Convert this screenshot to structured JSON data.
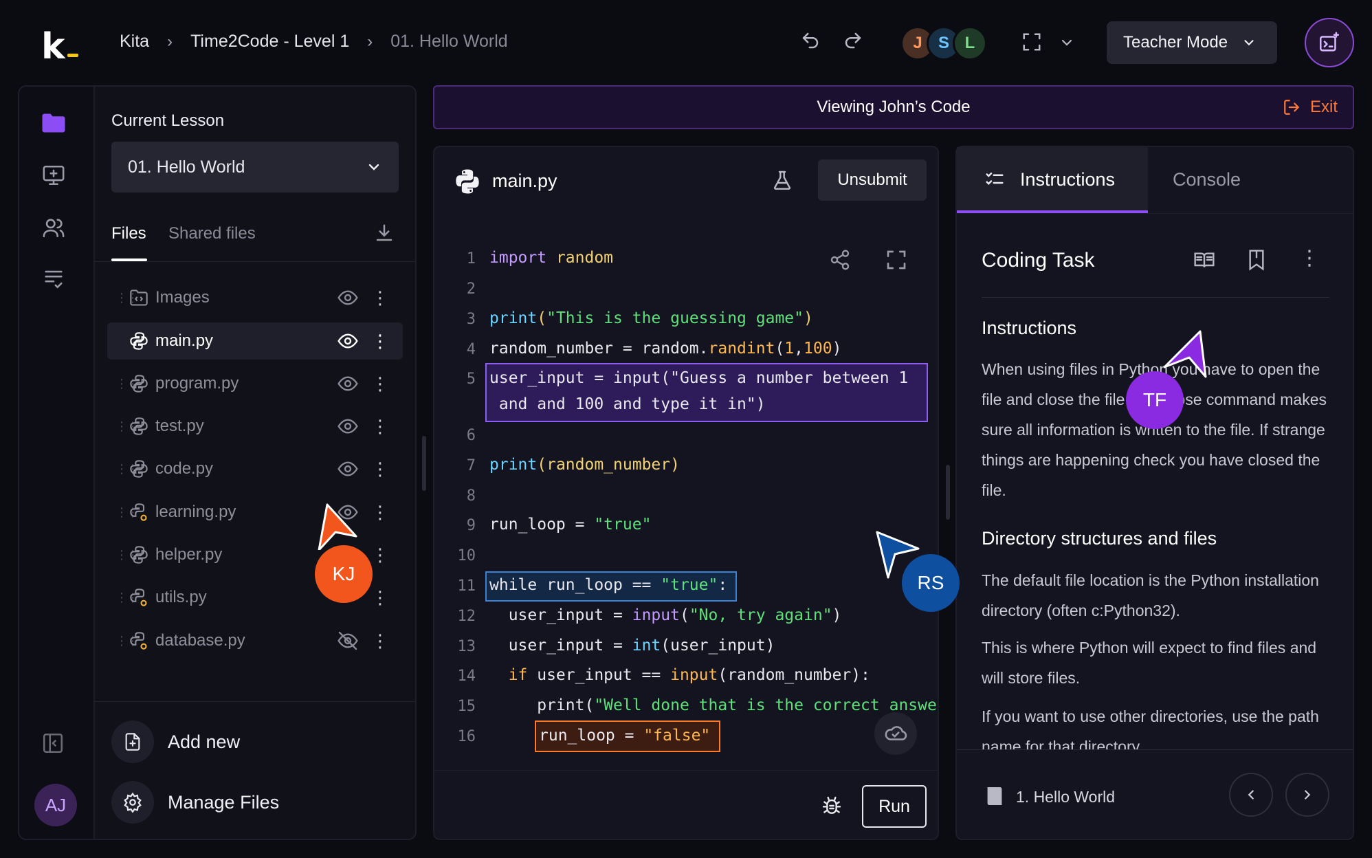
{
  "app": {
    "logo": "k",
    "logo_suffix": "_"
  },
  "breadcrumb": [
    "Kita",
    "Time2Code - Level 1",
    "01. Hello World"
  ],
  "collaborators": [
    {
      "initial": "J",
      "bg": "#4a2f24",
      "fg": "#ff9a62"
    },
    {
      "initial": "S",
      "bg": "#183046",
      "fg": "#6bc6ff"
    },
    {
      "initial": "L",
      "bg": "#1f3a26",
      "fg": "#7fdc8a"
    }
  ],
  "mode_select": {
    "label": "Teacher Mode"
  },
  "sidebar": {
    "user_initials": "AJ"
  },
  "files_panel": {
    "current_lesson_label": "Current Lesson",
    "lesson_selected": "01. Hello World",
    "tabs": [
      "Files",
      "Shared files"
    ],
    "files": [
      {
        "name": "Images",
        "icon": "folder-code-icon",
        "visibility": "visible"
      },
      {
        "name": "main.py",
        "icon": "python-icon",
        "visibility": "visible",
        "selected": true
      },
      {
        "name": "program.py",
        "icon": "python-icon",
        "visibility": "visible"
      },
      {
        "name": "test.py",
        "icon": "python-icon",
        "visibility": "visible"
      },
      {
        "name": "code.py",
        "icon": "python-icon",
        "visibility": "visible"
      },
      {
        "name": "learning.py",
        "icon": "python-icon",
        "visibility": "visible"
      },
      {
        "name": "helper.py",
        "icon": "python-icon",
        "visibility": "visible"
      },
      {
        "name": "utils.py",
        "icon": "python-icon",
        "visibility": "visible"
      },
      {
        "name": "database.py",
        "icon": "python-icon",
        "visibility": "hidden"
      }
    ],
    "add_new_label": "Add new",
    "manage_files_label": "Manage Files"
  },
  "banner": {
    "text": "Viewing John’s Code",
    "exit_label": "Exit"
  },
  "editor": {
    "filename": "main.py",
    "unsubmit_label": "Unsubmit",
    "run_label": "Run",
    "line_numbers": [
      "1",
      "2",
      "3",
      "4",
      "5",
      "6",
      "7",
      "8",
      "9",
      "10",
      "11",
      "12",
      "13",
      "14",
      "15",
      "16"
    ],
    "lines": {
      "l1": [
        "import",
        " random"
      ],
      "l3": [
        "print",
        "(",
        "\"This is the guessing game\"",
        ")"
      ],
      "l4": [
        "random_number = random.",
        "randint",
        "(",
        "1",
        ",",
        "100",
        ")"
      ],
      "l5a": "user_input = input(\"Guess a number between 1",
      "l5b": " and and 100 and type it in\")",
      "l7": [
        "print",
        "(random_number)"
      ],
      "l9": [
        "run_loop = ",
        "\"true\""
      ],
      "l11": [
        "while run_loop == ",
        "\"true\"",
        ":"
      ],
      "l12": [
        "  user_input = ",
        "input",
        "(",
        "\"No, try again\"",
        ")"
      ],
      "l13": [
        "  user_input = ",
        "int",
        "(user_input)"
      ],
      "l14": [
        "  if",
        " user_input == ",
        "input",
        "(random_number):"
      ],
      "l15": [
        "     print(",
        "\"Well done that is the correct answer\""
      ],
      "l16": [
        "run_loop = ",
        "\"false\""
      ]
    }
  },
  "right_panel": {
    "tabs": [
      "Instructions",
      "Console"
    ],
    "title": "Coding Task",
    "section1_title": "Instructions",
    "section1_text": "When using files in Python you have to open the file and close the file. The close command makes sure all information is written to the file. If strange things are happening check you have closed the file.",
    "section2_title": "Directory structures and files",
    "section2_p1": "The default file location is the Python installation directory (often c:Python32).",
    "section2_p2": "This is where Python will expect to find files and will store files.",
    "section2_p3": "If you want to use other directories, use the path name for that directory.",
    "footer_lesson": "1. Hello World"
  },
  "cursors": [
    {
      "initials": "KJ",
      "color": "#f2561d"
    },
    {
      "initials": "RS",
      "color": "#0f4fa0"
    },
    {
      "initials": "TF",
      "color": "#8a2be2"
    }
  ]
}
